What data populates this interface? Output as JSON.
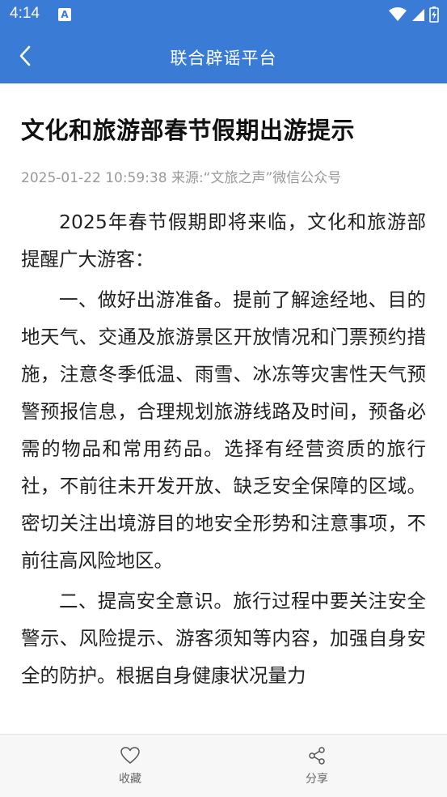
{
  "status_bar": {
    "time": "4:14",
    "app_icon_letter": "A",
    "icons": [
      "wifi-icon",
      "signal-icon",
      "battery-icon"
    ]
  },
  "app_bar": {
    "title": "联合辟谣平台",
    "back_icon": "chevron-left-icon",
    "background_color": "#3a7bd5"
  },
  "article": {
    "title": "文化和旅游部春节假期出游提示",
    "meta": "2025-01-22 10:59:38  来源:“文旅之声”微信公众号",
    "paragraphs": [
      "2025年春节假期即将来临，文化和旅游部提醒广大游客：",
      "一、做好出游准备。提前了解途经地、目的地天气、交通及旅游景区开放情况和门票预约措施，注意冬季低温、雨雪、冰冻等灾害性天气预警预报信息，合理规划旅游线路及时间，预备必需的物品和常用药品。选择有经营资质的旅行社，不前往未开发开放、缺乏安全保障的区域。密切关注出境游目的地安全形势和注意事项，不前往高风险地区。",
      "二、提高安全意识。旅行过程中要关注安全警示、风险提示、游客须知等内容，加强自身安全的防护。根据自身健康状况量力"
    ]
  },
  "bottom_bar": {
    "favorite_label": "收藏",
    "favorite_icon": "heart-icon",
    "share_label": "分享",
    "share_icon": "share-icon"
  }
}
